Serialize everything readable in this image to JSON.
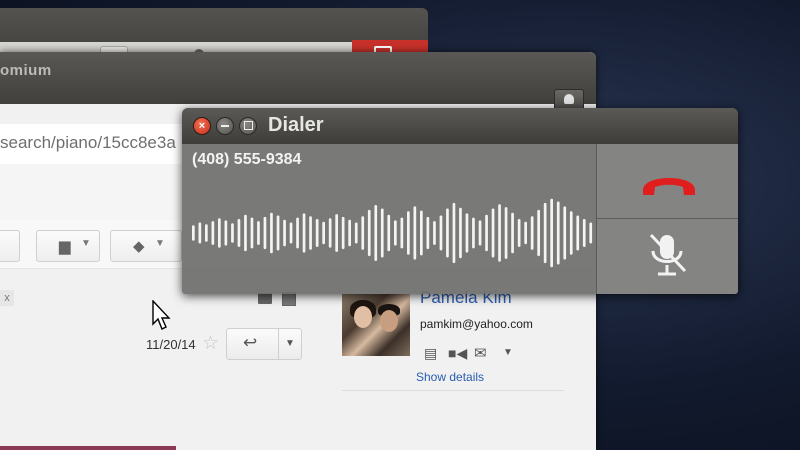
{
  "browser": {
    "title_fragment": "omium",
    "url_fragment": "search/piano/15cc8e3a"
  },
  "email": {
    "date": "11/20/14",
    "close_chip": "x"
  },
  "contact": {
    "name": "Pamela Kim",
    "email": "pamkim@yahoo.com",
    "show_details": "Show details"
  },
  "dialer": {
    "title": "Dialer",
    "phone_number": "(408) 555-9384",
    "close_glyph": "×",
    "hangup_color": "#e01e1e",
    "wave_levels": [
      0.22,
      0.3,
      0.25,
      0.34,
      0.42,
      0.36,
      0.28,
      0.4,
      0.52,
      0.44,
      0.34,
      0.46,
      0.58,
      0.5,
      0.38,
      0.3,
      0.44,
      0.56,
      0.48,
      0.4,
      0.32,
      0.42,
      0.54,
      0.46,
      0.38,
      0.3,
      0.48,
      0.66,
      0.8,
      0.7,
      0.52,
      0.36,
      0.44,
      0.62,
      0.76,
      0.64,
      0.46,
      0.34,
      0.5,
      0.7,
      0.86,
      0.72,
      0.56,
      0.44,
      0.36,
      0.52,
      0.7,
      0.82,
      0.74,
      0.58,
      0.4,
      0.32,
      0.48,
      0.66,
      0.86,
      0.98,
      0.9,
      0.76,
      0.62,
      0.5,
      0.4,
      0.3
    ]
  },
  "icons": {
    "folder": "folder-icon",
    "tag": "tag-icon",
    "reply": "reply-icon",
    "star": "star-icon",
    "hangup": "phone-hangup-icon",
    "mute": "mic-muted-icon"
  }
}
